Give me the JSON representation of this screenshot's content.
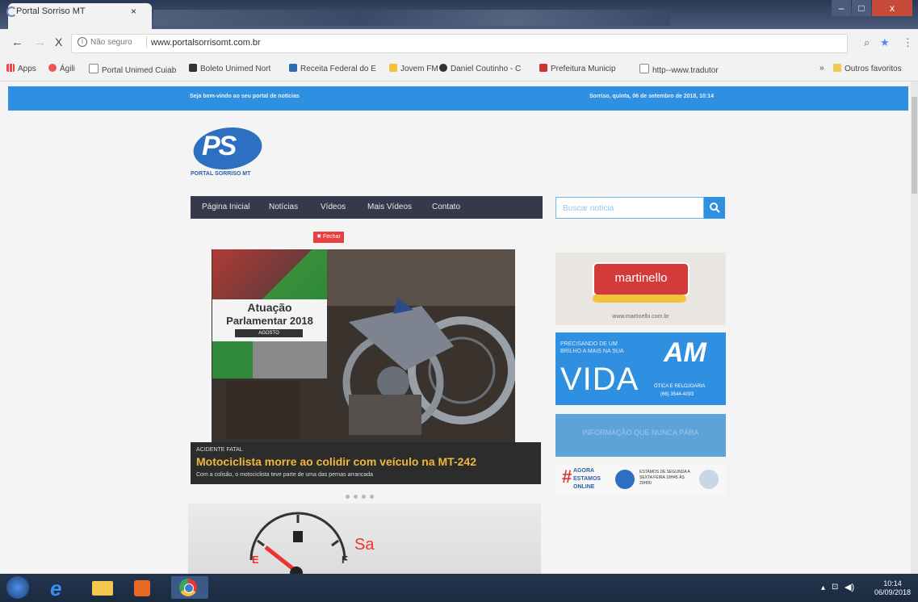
{
  "browser": {
    "tab_title": "Portal Sorriso MT",
    "tab_close": "×",
    "security_label": "Não seguro",
    "url": "www.portalsorrisomt.com.br",
    "back": "←",
    "forward": "→",
    "stop": "X",
    "window_min": "–",
    "window_max": "□",
    "window_close": "x"
  },
  "bookmarks": {
    "apps": "Apps",
    "items": [
      "Ágili",
      "Portal Unimed Cuiab",
      "Boleto Unimed Nort",
      "Receita Federal do E",
      "Jovem FM",
      "Daniel Coutinho - C",
      "Prefeitura Municip",
      "http--www.tradutor"
    ],
    "more": "»",
    "others": "Outros favoritos"
  },
  "site": {
    "welcome": "Seja bem-vindo ao seu portal de notícias",
    "date": "Sorriso, quinta, 06 de setembro de 2018, 10:14",
    "logo_text": "PS",
    "logo_sub": "PORTAL SORRISO MT",
    "nav": [
      "Página Inicial",
      "Notícias",
      "Vídeos",
      "Mais Vídeos",
      "Contato"
    ],
    "search_placeholder": "Buscar notícia",
    "close_label": "✖ Fechar",
    "slide": {
      "promo_title_1": "Atuação",
      "promo_title_2": "Parlamentar 2018",
      "promo_month": "AGOSTO",
      "kicker": "ACIDENTE FATAL",
      "title": "Motociclista morre ao colidir com veículo na MT-242",
      "subtitle": "Com a colisão, o motociclista teve parte de uma das pernas arrancada"
    },
    "fuel": {
      "e": "E",
      "f": "F",
      "brand": "Sa"
    },
    "ads": {
      "martinello": "martinello",
      "martinello_url": "www.martinello.com.br",
      "vida_pre": "PRECISANDO DE UM BRILHO A MAIS NA SUA",
      "vida": "VIDA",
      "vida_brand": "AM",
      "vida_tag": "ÓTICA E RELOJOARIA",
      "vida_phone": "(66) 3544-4093",
      "blue_text": "INFORMAÇÃO QUE NUNCA PÁRA",
      "online_1": "AGORA",
      "online_2": "ESTAMOS",
      "online_3": "ONLINE",
      "online_right": "ESTAMOS DE SEGUNDA A SEXTA FEIRA 19H45 ÀS 20H00"
    }
  },
  "taskbar": {
    "time": "10:14",
    "date": "06/09/2018"
  }
}
